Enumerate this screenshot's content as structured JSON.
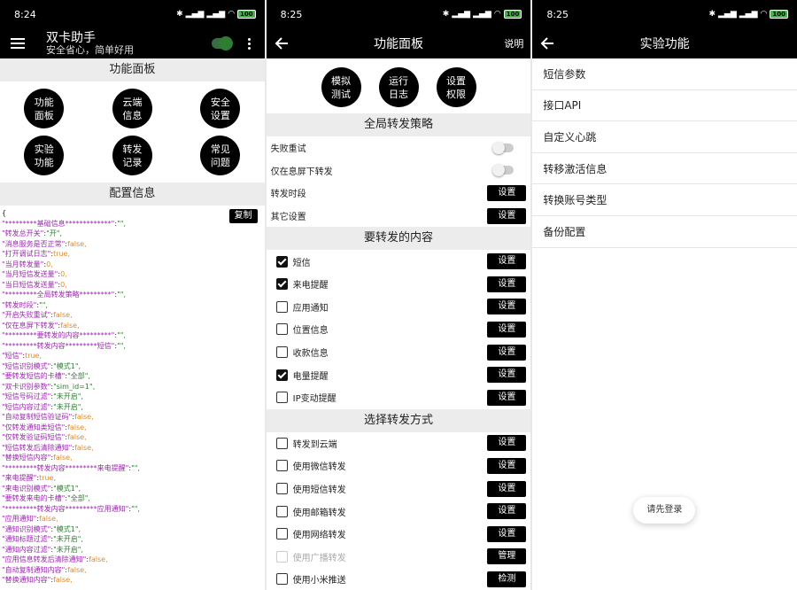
{
  "left": {
    "status_time": "8:24",
    "battery": "100",
    "app_title": "双卡助手",
    "app_subtitle": "安全省心，简单好用",
    "section_panel": "功能面板",
    "buttons": [
      "功能\n面板",
      "云端\n信息",
      "安全\n设置",
      "实验\n功能",
      "转发\n记录",
      "常见\n问题"
    ],
    "section_config": "配置信息",
    "copy_label": "复制",
    "config_lines": [
      "{",
      "  \"*********基础信息*************\":\"\",",
      "  \"转发总开关\":\"开\",",
      "  \"消息服务是否正常\":false,",
      "  \"打开调试日志\":true,",
      "  \"当月转发量\":0,",
      "  \"当月短信发送量\":0,",
      "  \"当日短信发送量\":0,",
      "  \"*********全局转发策略*********\":\"\",",
      "  \"转发时段\":\"\",",
      "  \"开启失败重试\":false,",
      "  \"仅在息屏下转发\":false,",
      "  \"*********要转发的内容*********\":\"\",",
      "  \"*********转发内容*********短信\":\"\",",
      "  \"短信\":true,",
      "  \"短信识别模式\":\"模式1\",",
      "  \"要转发短信的卡槽\":\"全部\",",
      "  \"双卡识别参数\":\"sim_id=1\",",
      "  \"短信号码过滤\":\"未开启\",",
      "  \"短信内容过滤\":\"未开启\",",
      "  \"自动复制短信验证码\":false,",
      "  \"仅转发通知类短信\":false,",
      "  \"仅转发验证码短信\":false,",
      "  \"短信转发后清除通知\":false,",
      "  \"替换短信内容\":false,",
      "  \"*********转发内容*********来电提醒\":\"\",",
      "  \"来电提醒\":true,",
      "  \"来电识别模式\":\"模式1\",",
      "  \"要转发来电的卡槽\":\"全部\",",
      "  \"*********转发内容*********应用通知\":\"\",",
      "  \"应用通知\":false,",
      "  \"通知识别模式\":\"模式1\",",
      "  \"通知标题过滤\":\"未开启\",",
      "  \"通知内容过滤\":\"未开启\",",
      "  \"应用信息转发后清除通知\":false,",
      "  \"自动复制通知内容\":false,",
      "  \"替换通知内容\":false,"
    ]
  },
  "middle": {
    "status_time": "8:25",
    "battery": "100",
    "title": "功能面板",
    "help_label": "说明",
    "top_buttons": [
      "模拟\n测试",
      "运行\n日志",
      "设置\n权限"
    ],
    "section_global": "全局转发策略",
    "global_rows": [
      {
        "label": "失败重试",
        "control": "switch"
      },
      {
        "label": "仅在息屏下转发",
        "control": "switch"
      },
      {
        "label": "转发时段",
        "control": "button",
        "button": "设置"
      },
      {
        "label": "其它设置",
        "control": "button",
        "button": "设置"
      }
    ],
    "section_content": "要转发的内容",
    "content_rows": [
      {
        "label": "短信",
        "checked": true,
        "button": "设置"
      },
      {
        "label": "来电提醒",
        "checked": true,
        "button": "设置"
      },
      {
        "label": "应用通知",
        "checked": false,
        "button": "设置"
      },
      {
        "label": "位置信息",
        "checked": false,
        "button": "设置"
      },
      {
        "label": "收款信息",
        "checked": false,
        "button": "设置"
      },
      {
        "label": "电量提醒",
        "checked": true,
        "button": "设置"
      },
      {
        "label": "IP变动提醒",
        "checked": false,
        "button": "设置"
      }
    ],
    "section_method": "选择转发方式",
    "method_rows": [
      {
        "label": "转发到云端",
        "checked": false,
        "button": "设置",
        "disabled": false
      },
      {
        "label": "使用微信转发",
        "checked": false,
        "button": "设置",
        "disabled": false
      },
      {
        "label": "使用短信转发",
        "checked": false,
        "button": "设置",
        "disabled": false
      },
      {
        "label": "使用邮箱转发",
        "checked": false,
        "button": "设置",
        "disabled": false
      },
      {
        "label": "使用网络转发",
        "checked": false,
        "button": "设置",
        "disabled": false
      },
      {
        "label": "使用广播转发",
        "checked": false,
        "button": "管理",
        "disabled": true
      },
      {
        "label": "使用小米推送",
        "checked": false,
        "button": "检测",
        "disabled": false
      }
    ]
  },
  "right": {
    "status_time": "8:25",
    "battery": "100",
    "title": "实验功能",
    "items": [
      "短信参数",
      "接口API",
      "自定义心跳",
      "转移激活信息",
      "转换账号类型",
      "备份配置"
    ],
    "toast": "请先登录"
  }
}
